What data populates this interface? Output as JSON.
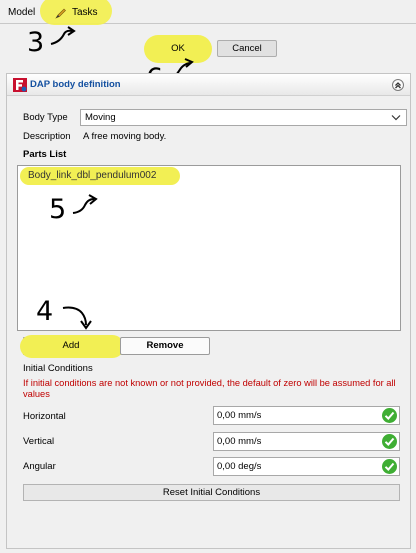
{
  "tabs": {
    "model_label": "Model",
    "tasks_label": "Tasks"
  },
  "annotations": {
    "step3": "3",
    "step4": "4",
    "step5": "5",
    "step6": "6"
  },
  "dialog_buttons": {
    "ok_label": "OK",
    "cancel_label": "Cancel"
  },
  "panel": {
    "title": "DAP body definition",
    "body_type_label": "Body Type",
    "body_type_value": "Moving",
    "description_label": "Description",
    "description_value": "A free moving body.",
    "parts_list_label": "Parts List",
    "parts": [
      "Body_link_dbl_pendulum002"
    ],
    "add_label": "Add",
    "remove_label": "Remove",
    "initial_conditions_label": "Initial Conditions",
    "warning": "If initial conditions are not known or not provided, the default of zero will be assumed for all values",
    "horizontal_label": "Horizontal",
    "horizontal_value": "0,00 mm/s",
    "vertical_label": "Vertical",
    "vertical_value": "0,00 mm/s",
    "angular_label": "Angular",
    "angular_value": "0,00 deg/s",
    "reset_label": "Reset Initial Conditions"
  },
  "colors": {
    "highlight": "#f2ef54",
    "title_blue": "#1450a0",
    "warning_red": "#c00000",
    "check_green": "#3fae34"
  }
}
